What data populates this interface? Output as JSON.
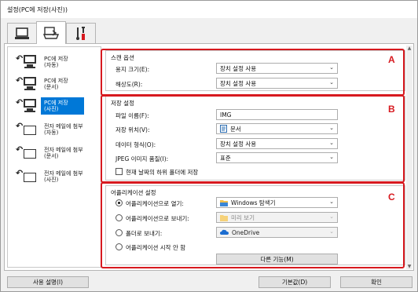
{
  "window": {
    "title": "설정(PC에 저장(사진))"
  },
  "tabs": [
    {
      "name": "scan-from-computer",
      "icon": "computer-icon"
    },
    {
      "name": "scan-from-operation-panel",
      "icon": "scanner-icon"
    },
    {
      "name": "general-settings",
      "icon": "tools-icon"
    }
  ],
  "sidebar": {
    "items": [
      {
        "line1": "PC에 저장",
        "line2": "(자동)",
        "icon": "save-to-pc-icon"
      },
      {
        "line1": "PC에 저장",
        "line2": "(문서)",
        "icon": "save-to-pc-icon"
      },
      {
        "line1": "PC에 저장",
        "line2": "(사진)",
        "icon": "save-to-pc-icon",
        "selected": true
      },
      {
        "line1": "전자 메일에 첨부",
        "line2": "(자동)",
        "icon": "attach-email-icon"
      },
      {
        "line1": "전자 메일에 첨부",
        "line2": "(문서)",
        "icon": "attach-email-icon"
      },
      {
        "line1": "전자 메일에 첨부",
        "line2": "(사진)",
        "icon": "attach-email-icon"
      }
    ]
  },
  "scan_options": {
    "title": "스캔 옵션",
    "marker": "A",
    "paper_size_label": "용지 크기(E):",
    "paper_size_value": "장치 설정 사용",
    "resolution_label": "해상도(R):",
    "resolution_value": "장치 설정 사용"
  },
  "save_settings": {
    "title": "저장 설정",
    "marker": "B",
    "filename_label": "파일 이름(F):",
    "filename_value": "IMG",
    "location_label": "저장 위치(V):",
    "location_value": "문서",
    "format_label": "데이터 형식(O):",
    "format_value": "장치 설정 사용",
    "jpeg_label": "JPEG 이미지 품질(I):",
    "jpeg_value": "표준",
    "subfolder_label": "현재 날짜의 하위 폴더에 저장"
  },
  "app_settings": {
    "title": "어플리케이션 설정",
    "marker": "C",
    "open_label": "어플리케이션으로 열기:",
    "open_value": "Windows 탐색기",
    "send_label": "어플리케이션으로 보내기:",
    "send_value": "미리 보기",
    "folder_label": "폴더로 보내기:",
    "folder_value": "OneDrive",
    "none_label": "어플리케이션 시작 안 함",
    "more_button": "다른 기능(M)"
  },
  "footer": {
    "instructions_button": "사용 설명(I)",
    "defaults_button": "기본값(D)",
    "ok_button": "확인"
  },
  "colors": {
    "marker_red": "#d7191f",
    "selection_blue": "#0078d7"
  }
}
